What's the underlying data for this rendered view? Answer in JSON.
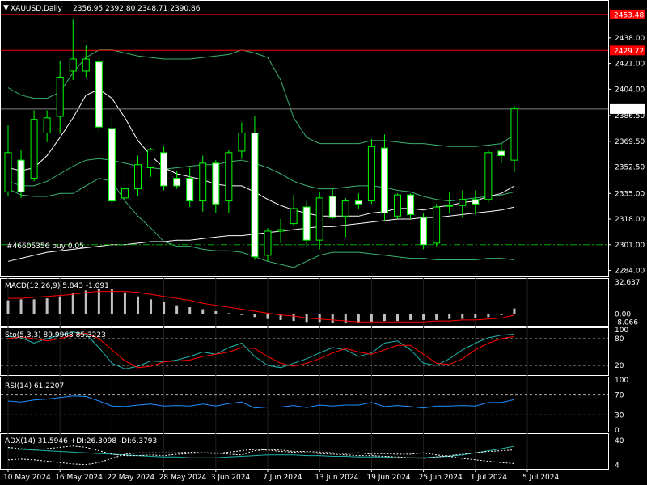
{
  "header": {
    "symbol_label": "XAUUSD,Daily",
    "ohlc_label": "2356.95 2392.80 2348.71 2390.86",
    "menu_glyph": "▼"
  },
  "colors": {
    "background": "#000000",
    "frame": "#ffffff",
    "bull_body": "#000000",
    "bear_body": "#ffffff",
    "candle_wick": "#00ff00",
    "bollinger": "#3cb371",
    "ma": "#ffffff",
    "hline_red": "#ff0000",
    "order_line": "#00aa00",
    "macd_hist": "#c0c0c0",
    "macd_signal": "#ff0000",
    "stoch_main": "#20b2aa",
    "stoch_signal": "#ff0000",
    "rsi": "#1e90ff",
    "adx": "#20b2aa",
    "plus_di": "#ffffff",
    "minus_di": "#ffffff"
  },
  "price_panel": {
    "order_label": "#46605356 buy 0.05",
    "hlines": [
      {
        "value": 2453.48,
        "label": "2453.48",
        "color": "#ff0000"
      },
      {
        "value": 2429.72,
        "label": "2429.72",
        "color": "#ff0000"
      },
      {
        "value": 2390.86,
        "label": "2390.86",
        "color": "#808080"
      }
    ],
    "order_price": 2301.0,
    "y_ticks": [
      "2438.00",
      "2421.00",
      "2404.00",
      "2386.50",
      "2369.50",
      "2352.50",
      "2335.00",
      "2318.00",
      "2301.00",
      "2284.00"
    ]
  },
  "chart_data": [
    {
      "type": "candlestick",
      "title": "XAUUSD,Daily",
      "ylim": [
        2280,
        2462
      ],
      "x_labels": [
        "10 May 2024",
        "16 May 2024",
        "22 May 2024",
        "28 May 2024",
        "3 Jun 2024",
        "7 Jun 2024",
        "13 Jun 2024",
        "19 Jun 2024",
        "25 Jun 2024",
        "1 Jul 2024",
        "5 Jul 2024"
      ],
      "candles": [
        {
          "o": 2336,
          "h": 2380,
          "l": 2333,
          "c": 2362
        },
        {
          "o": 2357,
          "h": 2364,
          "l": 2332,
          "c": 2336
        },
        {
          "o": 2345,
          "h": 2390,
          "l": 2343,
          "c": 2384
        },
        {
          "o": 2375,
          "h": 2390,
          "l": 2369,
          "c": 2385
        },
        {
          "o": 2386,
          "h": 2423,
          "l": 2375,
          "c": 2412
        },
        {
          "o": 2416,
          "h": 2450,
          "l": 2410,
          "c": 2424
        },
        {
          "o": 2416,
          "h": 2433,
          "l": 2412,
          "c": 2424
        },
        {
          "o": 2422,
          "h": 2425,
          "l": 2375,
          "c": 2379
        },
        {
          "o": 2378,
          "h": 2386,
          "l": 2328,
          "c": 2330
        },
        {
          "o": 2332,
          "h": 2355,
          "l": 2325,
          "c": 2338
        },
        {
          "o": 2338,
          "h": 2360,
          "l": 2333,
          "c": 2354
        },
        {
          "o": 2352,
          "h": 2365,
          "l": 2346,
          "c": 2364
        },
        {
          "o": 2362,
          "h": 2366,
          "l": 2337,
          "c": 2340
        },
        {
          "o": 2345,
          "h": 2350,
          "l": 2338,
          "c": 2340
        },
        {
          "o": 2345,
          "h": 2352,
          "l": 2326,
          "c": 2330
        },
        {
          "o": 2330,
          "h": 2360,
          "l": 2323,
          "c": 2355
        },
        {
          "o": 2355,
          "h": 2357,
          "l": 2322,
          "c": 2328
        },
        {
          "o": 2330,
          "h": 2364,
          "l": 2322,
          "c": 2362
        },
        {
          "o": 2363,
          "h": 2382,
          "l": 2358,
          "c": 2375
        },
        {
          "o": 2375,
          "h": 2386,
          "l": 2291,
          "c": 2293
        },
        {
          "o": 2294,
          "h": 2312,
          "l": 2290,
          "c": 2310
        },
        {
          "o": 2310,
          "h": 2318,
          "l": 2302,
          "c": 2311
        },
        {
          "o": 2315,
          "h": 2334,
          "l": 2313,
          "c": 2325
        },
        {
          "o": 2326,
          "h": 2330,
          "l": 2300,
          "c": 2304
        },
        {
          "o": 2304,
          "h": 2336,
          "l": 2298,
          "c": 2332
        },
        {
          "o": 2333,
          "h": 2338,
          "l": 2318,
          "c": 2319
        },
        {
          "o": 2320,
          "h": 2332,
          "l": 2306,
          "c": 2330
        },
        {
          "o": 2330,
          "h": 2335,
          "l": 2325,
          "c": 2328
        },
        {
          "o": 2330,
          "h": 2371,
          "l": 2328,
          "c": 2366
        },
        {
          "o": 2365,
          "h": 2374,
          "l": 2317,
          "c": 2322
        },
        {
          "o": 2320,
          "h": 2335,
          "l": 2318,
          "c": 2334
        },
        {
          "o": 2334,
          "h": 2335,
          "l": 2318,
          "c": 2321
        },
        {
          "o": 2319,
          "h": 2322,
          "l": 2298,
          "c": 2301
        },
        {
          "o": 2302,
          "h": 2328,
          "l": 2300,
          "c": 2326
        },
        {
          "o": 2327,
          "h": 2336,
          "l": 2322,
          "c": 2327
        },
        {
          "o": 2327,
          "h": 2337,
          "l": 2319,
          "c": 2331
        },
        {
          "o": 2331,
          "h": 2337,
          "l": 2321,
          "c": 2328
        },
        {
          "o": 2331,
          "h": 2364,
          "l": 2329,
          "c": 2362
        },
        {
          "o": 2363,
          "h": 2368,
          "l": 2355,
          "c": 2360
        },
        {
          "o": 2357,
          "h": 2393,
          "l": 2349,
          "c": 2391
        }
      ],
      "bollinger_upper": [
        2405,
        2400,
        2398,
        2398,
        2402,
        2415,
        2425,
        2430,
        2430,
        2428,
        2426,
        2425,
        2424,
        2424,
        2424,
        2425,
        2426,
        2427,
        2430,
        2428,
        2425,
        2410,
        2385,
        2372,
        2368,
        2368,
        2368,
        2368,
        2370,
        2370,
        2369,
        2368,
        2368,
        2367,
        2366,
        2366,
        2366,
        2367,
        2368,
        2374
      ],
      "bollinger_middle": [
        2343,
        2340,
        2340,
        2343,
        2348,
        2353,
        2357,
        2358,
        2357,
        2355,
        2353,
        2352,
        2351,
        2352,
        2353,
        2354,
        2354,
        2356,
        2357,
        2355,
        2352,
        2348,
        2343,
        2340,
        2338,
        2338,
        2339,
        2340,
        2340,
        2339,
        2337,
        2336,
        2333,
        2331,
        2330,
        2331,
        2332,
        2333,
        2334,
        2336
      ],
      "bollinger_lower": [
        2338,
        2334,
        2333,
        2333,
        2335,
        2335,
        2340,
        2345,
        2343,
        2330,
        2320,
        2312,
        2303,
        2300,
        2300,
        2298,
        2297,
        2297,
        2296,
        2293,
        2290,
        2288,
        2286,
        2290,
        2294,
        2296,
        2296,
        2296,
        2295,
        2294,
        2293,
        2292,
        2292,
        2291,
        2291,
        2291,
        2291,
        2292,
        2292,
        2291
      ],
      "ma_fast": [
        2352,
        2350,
        2352,
        2360,
        2372,
        2385,
        2400,
        2404,
        2398,
        2385,
        2370,
        2360,
        2352,
        2348,
        2346,
        2344,
        2341,
        2340,
        2340,
        2336,
        2331,
        2327,
        2324,
        2322,
        2320,
        2320,
        2320,
        2320,
        2322,
        2323,
        2325,
        2325,
        2324,
        2326,
        2327,
        2329,
        2330,
        2333,
        2335,
        2340
      ],
      "ma_slow": [
        2290,
        2292,
        2294,
        2296,
        2297,
        2298,
        2299,
        2300,
        2301,
        2301,
        2302,
        2303,
        2303,
        2304,
        2304,
        2305,
        2306,
        2307,
        2307,
        2308,
        2309,
        2310,
        2311,
        2312,
        2313,
        2313,
        2314,
        2315,
        2316,
        2317,
        2318,
        2318,
        2319,
        2319,
        2320,
        2321,
        2322,
        2323,
        2324,
        2326
      ]
    },
    {
      "type": "bar",
      "title": "MACD(12,26,9) 5.843 -1.091",
      "ylim": [
        -11,
        35
      ],
      "y_ticks": [
        "32.637",
        "0.00",
        "-8.066"
      ],
      "histogram": [
        14,
        15,
        15,
        16,
        18,
        21,
        24,
        26,
        25,
        22,
        18,
        15,
        12,
        9,
        7,
        5,
        3,
        1,
        -1,
        -3,
        -5,
        -6,
        -7,
        -8,
        -8,
        -9,
        -9,
        -9,
        -8,
        -7,
        -7,
        -6,
        -6,
        -6,
        -5,
        -5,
        -4,
        -3,
        -1,
        5.8
      ],
      "signal": [
        16,
        16,
        17,
        18,
        19,
        20,
        22,
        23,
        23,
        23,
        22,
        20,
        18,
        16,
        14,
        11,
        9,
        7,
        5,
        3,
        1,
        -1,
        -2,
        -4,
        -5,
        -6,
        -7,
        -8,
        -8,
        -8,
        -8,
        -8,
        -8,
        -7,
        -7,
        -6,
        -6,
        -5,
        -4,
        -1.1
      ]
    },
    {
      "type": "line",
      "title": "Sto(5,3,3) 89.9968 85.3223",
      "ylim": [
        0,
        100
      ],
      "levels": [
        80,
        20
      ],
      "y_ticks": [
        "100",
        "80",
        "20"
      ],
      "series": [
        {
          "name": "main",
          "values": [
            85,
            82,
            70,
            80,
            88,
            95,
            90,
            60,
            25,
            12,
            18,
            30,
            28,
            32,
            40,
            50,
            45,
            60,
            70,
            40,
            20,
            15,
            25,
            35,
            48,
            60,
            55,
            40,
            48,
            70,
            75,
            55,
            25,
            20,
            35,
            55,
            70,
            82,
            88,
            90
          ]
        },
        {
          "name": "signal",
          "values": [
            80,
            84,
            80,
            75,
            80,
            88,
            92,
            80,
            55,
            30,
            15,
            18,
            28,
            30,
            32,
            40,
            45,
            50,
            60,
            58,
            40,
            25,
            18,
            25,
            35,
            48,
            58,
            50,
            45,
            55,
            65,
            65,
            45,
            25,
            22,
            35,
            55,
            70,
            80,
            85
          ]
        }
      ]
    },
    {
      "type": "line",
      "title": "RSI(14) 61.2207",
      "ylim": [
        0,
        100
      ],
      "levels": [
        70,
        30
      ],
      "y_ticks": [
        "100",
        "70",
        "30",
        "0"
      ],
      "series": [
        {
          "name": "RSI",
          "values": [
            58,
            56,
            60,
            62,
            65,
            68,
            67,
            58,
            48,
            47,
            50,
            52,
            48,
            49,
            48,
            52,
            48,
            53,
            56,
            44,
            46,
            46,
            49,
            45,
            50,
            48,
            50,
            50,
            55,
            47,
            49,
            47,
            44,
            48,
            48,
            49,
            48,
            55,
            55,
            61
          ]
        }
      ]
    },
    {
      "type": "line",
      "title": "ADX(14) 31.5946 +DI:26.3098 -DI:6.3793",
      "ylim": [
        0,
        48
      ],
      "y_ticks": [
        "40",
        "4"
      ],
      "series": [
        {
          "name": "ADX",
          "values": [
            28,
            27,
            26,
            25,
            24,
            23,
            22,
            21,
            20,
            19,
            18,
            17,
            16,
            16,
            15,
            15,
            15,
            16,
            17,
            18,
            19,
            19,
            19,
            18,
            18,
            17,
            17,
            16,
            16,
            16,
            15,
            15,
            15,
            16,
            17,
            19,
            22,
            25,
            28,
            31.6
          ]
        },
        {
          "name": "+DI",
          "values": [
            30,
            28,
            27,
            28,
            30,
            32,
            30,
            25,
            20,
            18,
            18,
            19,
            18,
            20,
            21,
            22,
            21,
            23,
            25,
            27,
            26,
            24,
            23,
            22,
            21,
            20,
            19,
            18,
            18,
            17,
            16,
            15,
            14,
            16,
            18,
            20,
            22,
            24,
            25,
            26.3
          ]
        },
        {
          "name": "-DI",
          "values": [
            12,
            13,
            12,
            10,
            8,
            6,
            5,
            8,
            14,
            20,
            22,
            22,
            22,
            22,
            23,
            22,
            22,
            20,
            19,
            25,
            27,
            26,
            24,
            24,
            23,
            22,
            21,
            22,
            20,
            21,
            20,
            20,
            22,
            19,
            17,
            14,
            12,
            10,
            8,
            6.4
          ]
        }
      ]
    }
  ]
}
